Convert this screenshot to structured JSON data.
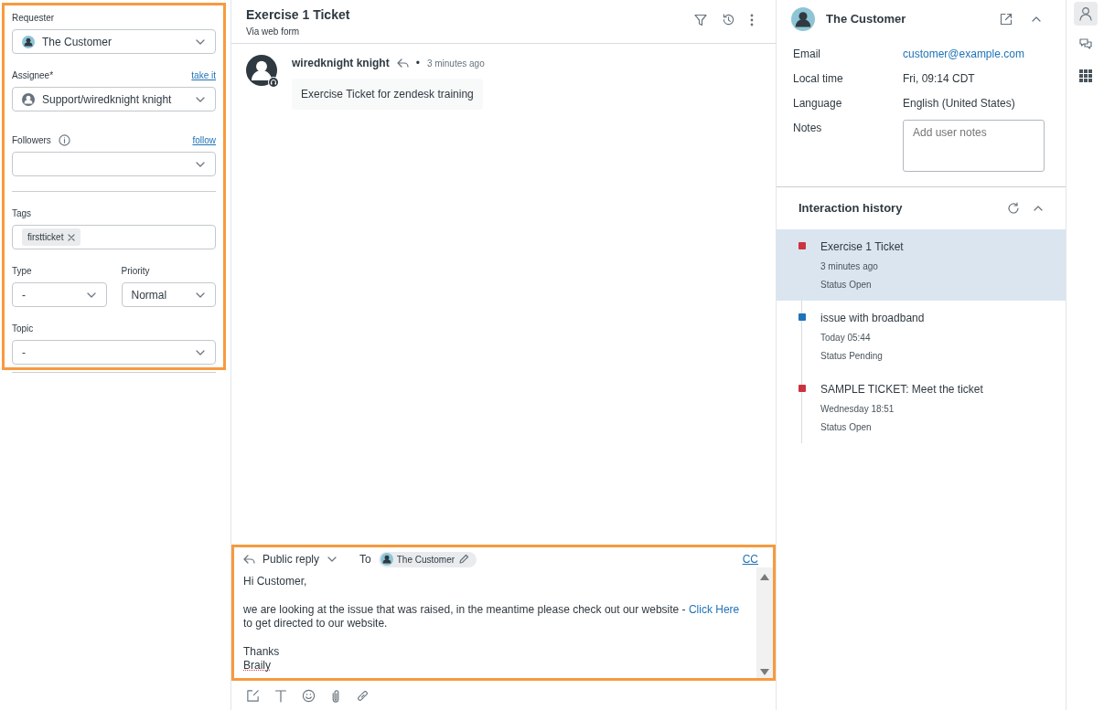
{
  "ticket_fields": {
    "requester": {
      "label": "Requester",
      "value": "The Customer"
    },
    "assignee": {
      "label": "Assignee*",
      "link": "take it",
      "value": "Support/wiredknight knight"
    },
    "followers": {
      "label": "Followers",
      "link": "follow"
    },
    "tags": {
      "label": "Tags",
      "items": [
        "firstticket"
      ]
    },
    "type": {
      "label": "Type",
      "value": "-"
    },
    "priority": {
      "label": "Priority",
      "value": "Normal"
    },
    "topic": {
      "label": "Topic",
      "value": "-"
    }
  },
  "ticket": {
    "title": "Exercise 1 Ticket",
    "subtitle": "Via web form",
    "messages": [
      {
        "author": "wiredknight knight",
        "separator": "•",
        "time": "3 minutes ago",
        "body": "Exercise Ticket for zendesk training"
      }
    ]
  },
  "reply": {
    "mode": "Public reply",
    "to_label": "To",
    "recipient": "The Customer",
    "cc": "CC",
    "greeting": "Hi Customer,",
    "paragraph": {
      "before": "we are looking at the issue that was raised, in the meantime please check out our website - ",
      "link": "Click Here",
      "after": " to get directed to our website."
    },
    "closing": [
      {
        "text": "Thanks",
        "misspelled": false
      },
      {
        "text": "Braily",
        "misspelled": true
      }
    ]
  },
  "customer": {
    "name": "The Customer",
    "details": [
      {
        "kind": "link",
        "label": "Email",
        "value": "customer@example.com"
      },
      {
        "kind": "text",
        "label": "Local time",
        "value": "Fri, 09:14 CDT"
      },
      {
        "kind": "text",
        "label": "Language",
        "value": "English (United States)"
      },
      {
        "kind": "notes",
        "label": "Notes",
        "placeholder": "Add user notes"
      }
    ]
  },
  "interaction_history": {
    "title": "Interaction history",
    "items": [
      {
        "title": "Exercise 1 Ticket",
        "time": "3 minutes ago",
        "status": "Status Open",
        "color": "#cc3340",
        "selected": true
      },
      {
        "title": "issue with broadband",
        "time": "Today 05:44",
        "status": "Status Pending",
        "color": "#1f73b7",
        "selected": false
      },
      {
        "title": "SAMPLE TICKET: Meet the ticket",
        "time": "Wednesday 18:51",
        "status": "Status Open",
        "color": "#cc3340",
        "selected": false
      }
    ]
  },
  "rail": [
    {
      "kind": "user",
      "selected": true
    },
    {
      "kind": "chat",
      "selected": false
    },
    {
      "kind": "apps",
      "selected": false
    }
  ]
}
